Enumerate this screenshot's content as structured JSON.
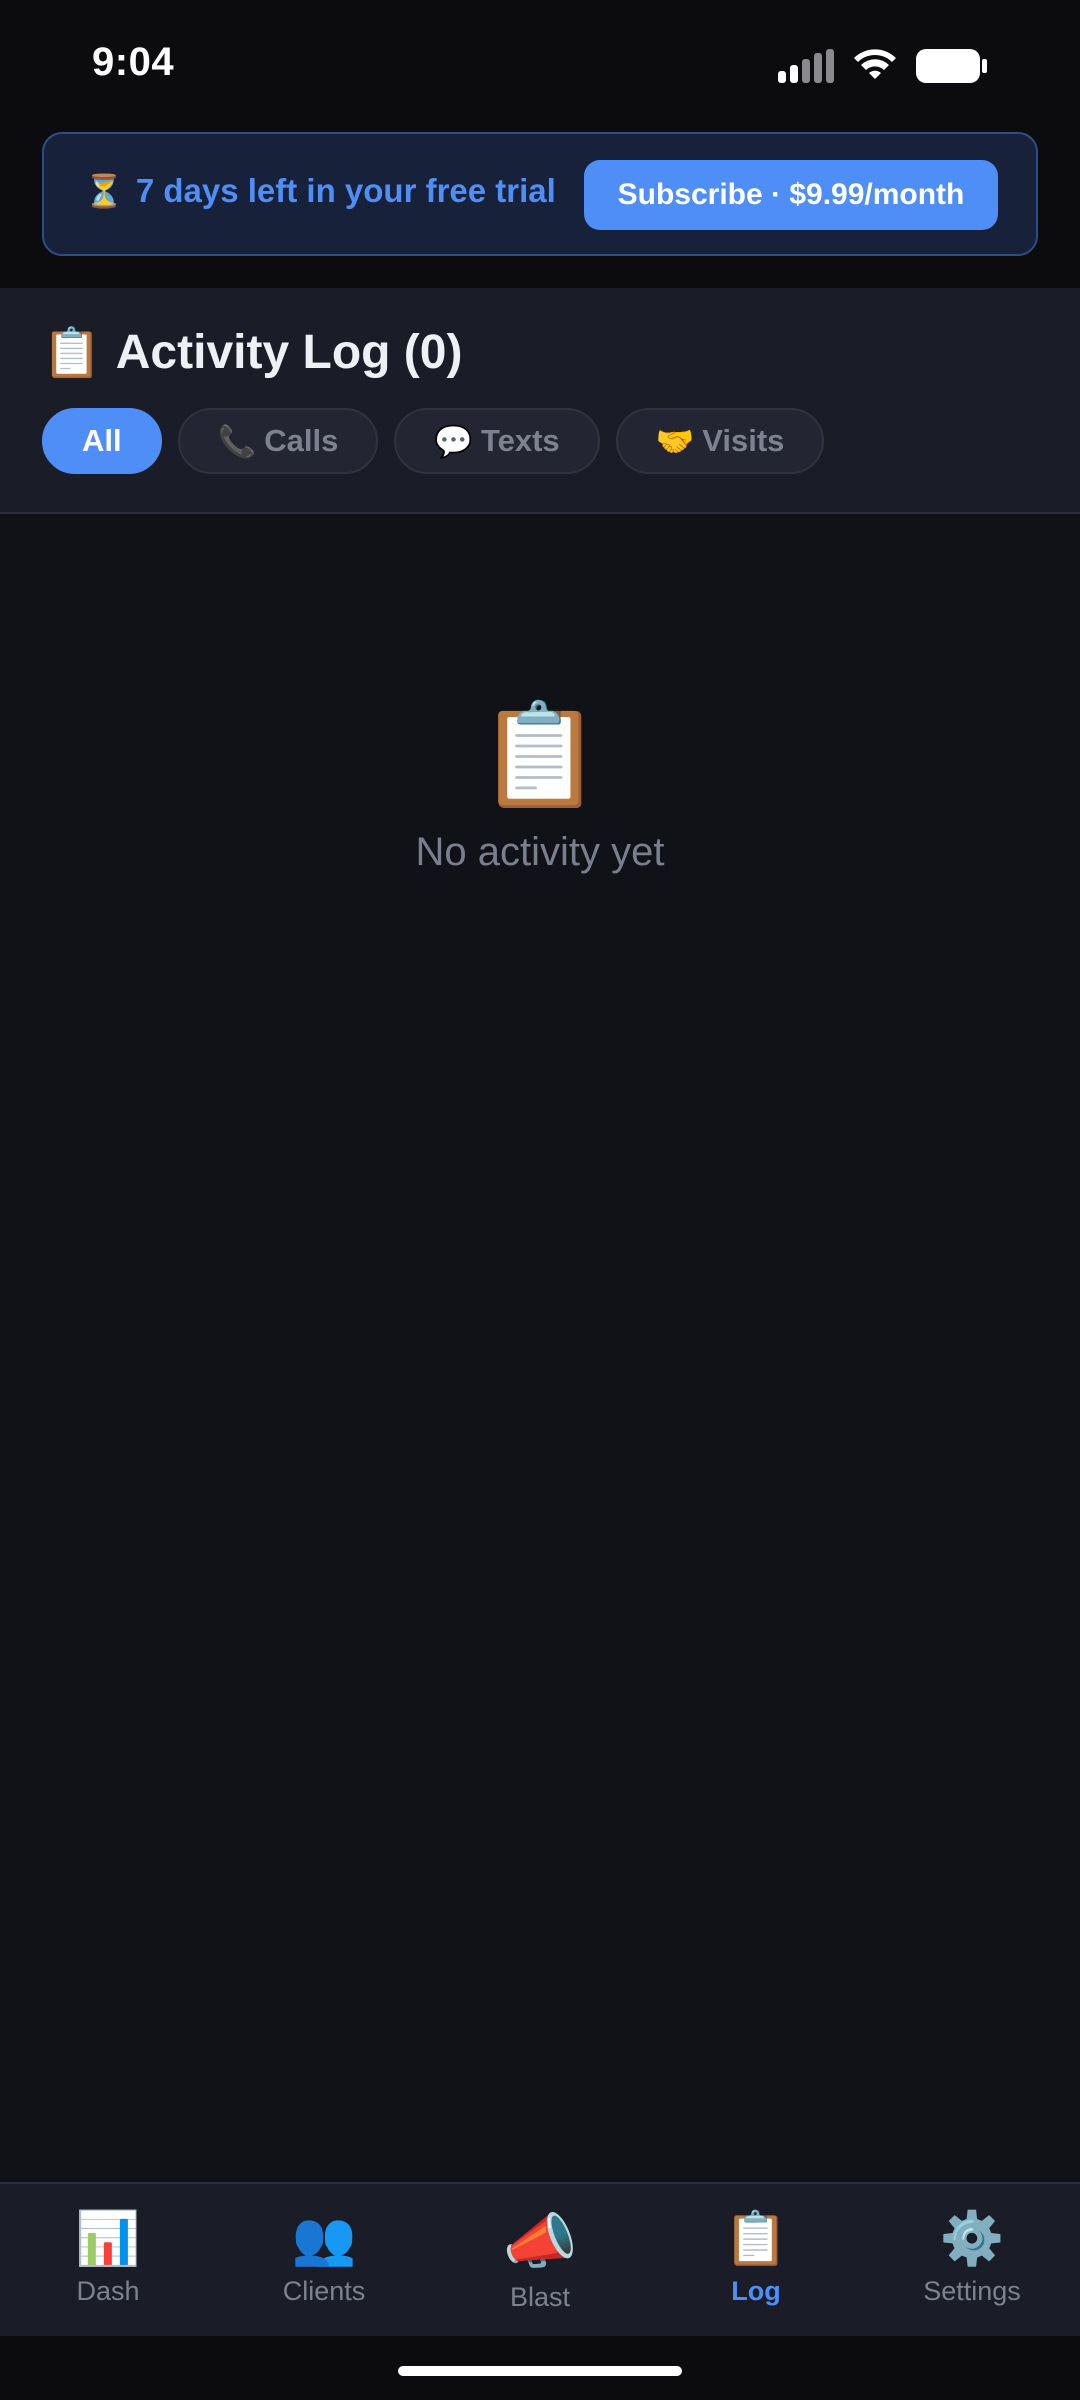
{
  "status_bar": {
    "time": "9:04"
  },
  "trial_banner": {
    "icon": "⏳",
    "text": "7 days left in your free trial",
    "subscribe_label": "Subscribe · $9.99/month"
  },
  "header": {
    "icon": "📋",
    "title": "Activity Log (0)"
  },
  "filters": [
    {
      "icon": "",
      "label": "All",
      "active": true
    },
    {
      "icon": "📞",
      "label": "Calls",
      "active": false
    },
    {
      "icon": "💬",
      "label": "Texts",
      "active": false
    },
    {
      "icon": "🤝",
      "label": "Visits",
      "active": false
    }
  ],
  "empty_state": {
    "icon": "📋",
    "text": "No activity yet"
  },
  "bottom_nav": [
    {
      "icon": "📊",
      "label": "Dash",
      "active": false
    },
    {
      "icon": "👥",
      "label": "Clients",
      "active": false
    },
    {
      "icon": "📣",
      "label": "Blast",
      "active": false
    },
    {
      "icon": "📋",
      "label": "Log",
      "active": true
    },
    {
      "icon": "⚙️",
      "label": "Settings",
      "active": false
    }
  ],
  "colors": {
    "accent": "#4f8ef7",
    "background": "#111217",
    "surface": "#1a1d27"
  }
}
